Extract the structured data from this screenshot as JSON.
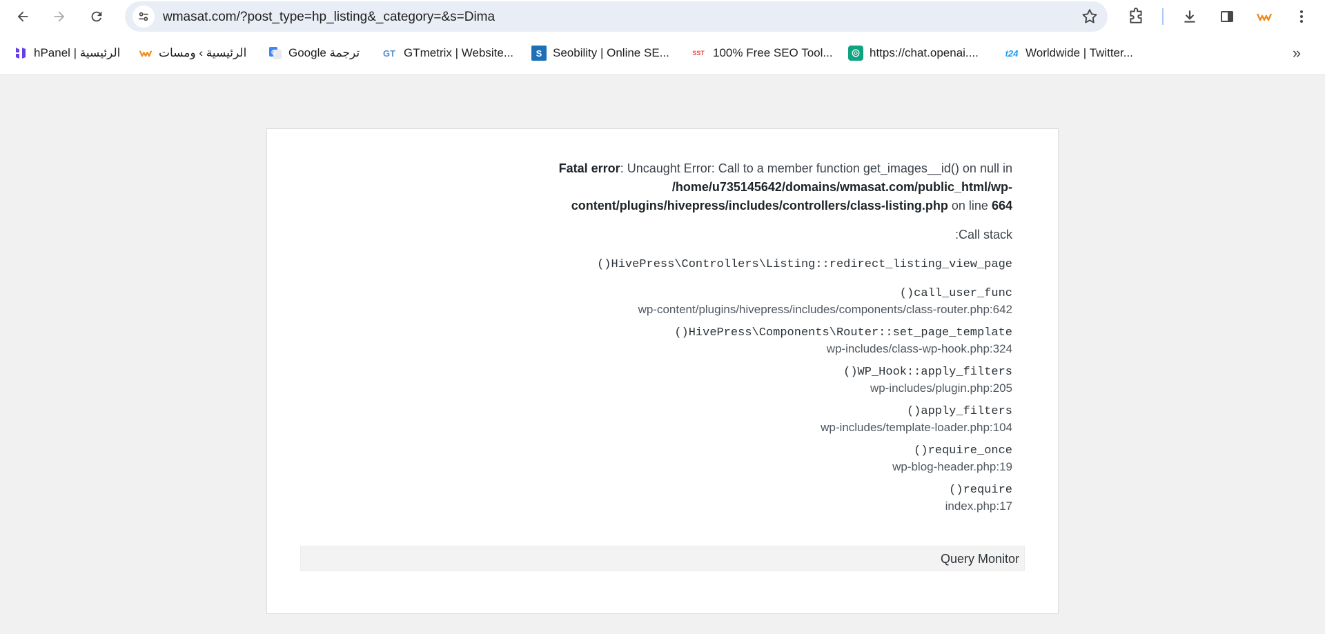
{
  "browser": {
    "url": "wmasat.com/?post_type=hp_listing&_category=&s=Dima"
  },
  "bookmarks": [
    {
      "label": "hPanel | الرئيسية",
      "icon": "hostinger-icon"
    },
    {
      "label": "الرئيسية › ومسات",
      "icon": "wmasat-icon"
    },
    {
      "label": "Google ترجمة",
      "icon": "google-translate-icon"
    },
    {
      "label": "GTmetrix | Website...",
      "icon": "gtmetrix-icon"
    },
    {
      "label": "Seobility | Online SE...",
      "icon": "seobility-icon"
    },
    {
      "label": "100% Free SEO Tool...",
      "icon": "sst-icon"
    },
    {
      "label": "https://chat.openai....",
      "icon": "openai-icon"
    },
    {
      "label": "Worldwide | Twitter...",
      "icon": "t24-icon"
    }
  ],
  "error": {
    "label": "Fatal error",
    "message": ": Uncaught Error: Call to a member function get_images__id() on null",
    "in_word": "in",
    "path": "/home/u735145642/domains/wmasat.com/public_html/wp-content/plugins/hivepress/includes/controllers/class-listing.php",
    "on_line_text": "on line",
    "line": "664",
    "callstack_title": ":Call stack"
  },
  "stack": [
    {
      "fn": "()HivePress\\Controllers\\Listing::redirect_listing_view_page",
      "loc": ""
    },
    {
      "fn": "()call_user_func",
      "loc": "wp-content/plugins/hivepress/includes/components/class-router.php:642"
    },
    {
      "fn": "()HivePress\\Components\\Router::set_page_template",
      "loc": "wp-includes/class-wp-hook.php:324"
    },
    {
      "fn": "()WP_Hook::apply_filters",
      "loc": "wp-includes/plugin.php:205"
    },
    {
      "fn": "()apply_filters",
      "loc": "wp-includes/template-loader.php:104"
    },
    {
      "fn": "()require_once",
      "loc": "wp-blog-header.php:19"
    },
    {
      "fn": "()require",
      "loc": "index.php:17"
    }
  ],
  "query_monitor": {
    "label": "Query Monitor"
  },
  "colors": {
    "omnibox_bg": "#e9eef6",
    "page_bg": "#f1f1f1",
    "separator": "#a8c7fa"
  }
}
